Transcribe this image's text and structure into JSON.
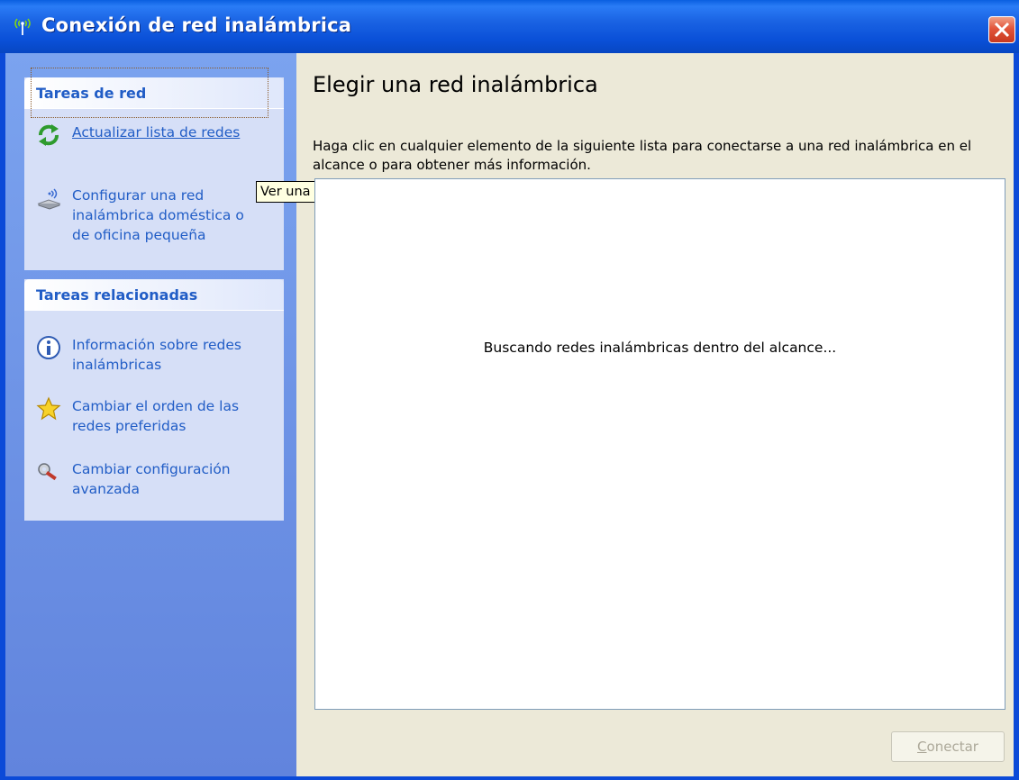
{
  "window": {
    "title": "Conexión de red inalámbrica",
    "close_icon": "close-icon"
  },
  "sidebar": {
    "panels": [
      {
        "title": "Tareas de red",
        "items": [
          {
            "label": "Actualizar lista de redes",
            "icon": "refresh-icon"
          },
          {
            "label": "Configurar una red inalámbrica doméstica o de oficina pequeña",
            "icon": "wireless-setup-icon"
          }
        ]
      },
      {
        "title": "Tareas relacionadas",
        "items": [
          {
            "label": "Información sobre redes inalámbricas",
            "icon": "info-icon"
          },
          {
            "label": "Cambiar el orden de las redes preferidas",
            "icon": "star-icon"
          },
          {
            "label": "Cambiar configuración avanzada",
            "icon": "settings-wrench-icon"
          }
        ]
      }
    ]
  },
  "tooltip": {
    "text": "Ver una lista actual"
  },
  "main": {
    "title": "Elegir una red inalámbrica",
    "instructions": "Haga clic en cualquier elemento de la siguiente lista para conectarse a una red inalámbrica en el alcance o para obtener más información.",
    "list_status": "Buscando redes inalámbricas dentro del alcance...",
    "connect_button": {
      "accelerator": "C",
      "rest": "onectar",
      "enabled": false
    }
  },
  "colors": {
    "titlebar": "#0a50d8",
    "sidebar": "#6b90e4",
    "panel": "#d6dff7",
    "link": "#215dc6",
    "close_button": "#e2563b"
  }
}
